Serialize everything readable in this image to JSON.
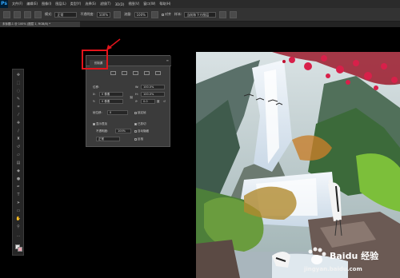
{
  "app": {
    "logo": "Ps"
  },
  "menubar": {
    "items": [
      "文件(F)",
      "编辑(E)",
      "图像(I)",
      "图层(L)",
      "类型(Y)",
      "选择(S)",
      "滤镜(T)",
      "3D(D)",
      "视图(V)",
      "窗口(W)",
      "帮助(H)"
    ]
  },
  "options_bar": {
    "mode_label": "模式:",
    "mode_value": "正常",
    "opacity_label": "不透明度:",
    "opacity_value": "100%",
    "flow_label": "流量:",
    "flow_value": "100%",
    "align_label": "对齐",
    "sample_label": "样本:",
    "sample_value": "当前和下方图层"
  },
  "document_tab": {
    "label": "未标题-1 @ 100% (图层 1, RGB/8) *"
  },
  "panel": {
    "tab_label": "仿制源",
    "offset_label": "位移:",
    "x_label": "X:",
    "x_value": "0 像素",
    "y_label": "Y:",
    "y_value": "0 像素",
    "w_label": "W:",
    "w_value": "100.0%",
    "h_label": "H:",
    "h_value": "100.0%",
    "angle_value": "0.0",
    "angle_unit": "度",
    "frame_offset_label": "帧位移:",
    "frame_offset_value": "0",
    "lock_frame_label": "锁定帧",
    "show_overlay_label": "显示叠加",
    "opacity_label": "不透明度:",
    "opacity_value": "100%",
    "clipped_label": "已剪切",
    "auto_hide_label": "自动隐藏",
    "mode_value": "正常",
    "invert_label": "反相"
  },
  "watermark": {
    "brand": "Baidu 经验",
    "url": "jingyan.baidu.com"
  },
  "colors": {
    "highlight": "#e3141b",
    "foreground": "#e8e8e8",
    "background": "#e7a6b3",
    "ui_dark": "#2b2b2b"
  }
}
